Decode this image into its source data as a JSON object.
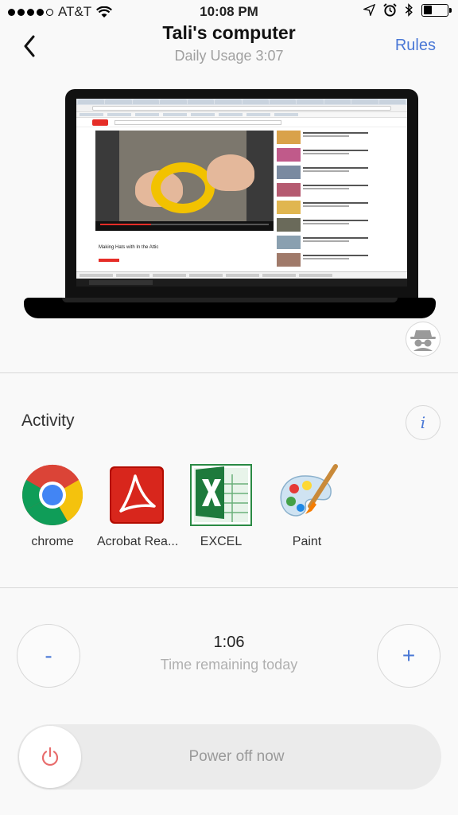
{
  "status_bar": {
    "carrier": "AT&T",
    "time": "10:08 PM",
    "signal_bars_filled": 4,
    "signal_bars_total": 5,
    "battery_level": 0.35
  },
  "header": {
    "title": "Tali's computer",
    "subtitle": "Daily Usage 3:07",
    "rules_label": "Rules"
  },
  "screenshot": {
    "video_title": "Making Hats with In the Attic"
  },
  "activity": {
    "label": "Activity",
    "info_label": "i",
    "apps": [
      {
        "name": "chrome",
        "icon": "chrome-icon"
      },
      {
        "name": "Acrobat Rea...",
        "icon": "acrobat-icon"
      },
      {
        "name": "EXCEL",
        "icon": "excel-icon"
      },
      {
        "name": "Paint",
        "icon": "paint-icon"
      }
    ]
  },
  "time_remaining": {
    "value": "1:06",
    "label": "Time remaining today",
    "decrease_label": "-",
    "increase_label": "+"
  },
  "power": {
    "label": "Power off now"
  },
  "colors": {
    "accent": "#4a78d6",
    "power_icon": "#e86c6c",
    "background": "#f9f9f9"
  }
}
